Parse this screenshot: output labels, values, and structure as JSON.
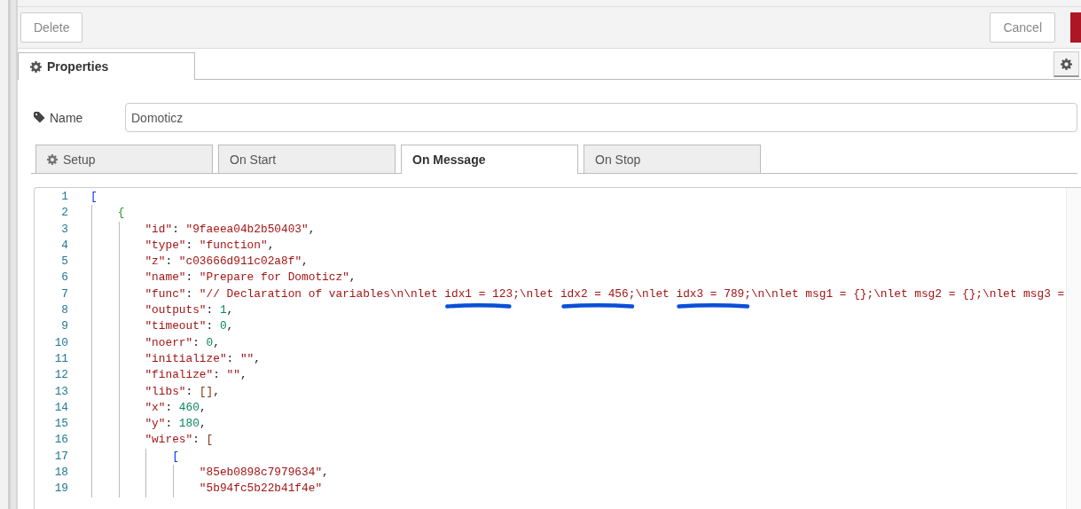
{
  "toolbar": {
    "delete_button": "Delete",
    "cancel_button": "Cancel"
  },
  "tray_tabs": [
    {
      "label": "Properties",
      "selected": true
    }
  ],
  "name_field": {
    "label": "Name",
    "value": "Domoticz"
  },
  "editor_tabs": [
    {
      "label": "Setup",
      "icon": true,
      "selected": false
    },
    {
      "label": "On Start",
      "icon": false,
      "selected": false
    },
    {
      "label": "On Message",
      "icon": false,
      "selected": true
    },
    {
      "label": "On Stop",
      "icon": false,
      "selected": false
    }
  ],
  "code": [
    {
      "number": "1",
      "tokens": [
        {
          "kind": "bracket1",
          "text": "["
        }
      ],
      "children": [
        {
          "number": "2",
          "tokens": [
            {
              "kind": "bracket2",
              "text": "{"
            }
          ],
          "children": [
            {
              "number": "3",
              "tokens": [
                {
                  "kind": "key",
                  "text": "\"id\""
                },
                {
                  "kind": "punct",
                  "text": ": "
                },
                {
                  "kind": "string",
                  "text": "\"9faeea04b2b50403\""
                },
                {
                  "kind": "punct",
                  "text": ","
                }
              ]
            },
            {
              "number": "4",
              "tokens": [
                {
                  "kind": "key",
                  "text": "\"type\""
                },
                {
                  "kind": "punct",
                  "text": ": "
                },
                {
                  "kind": "string",
                  "text": "\"function\""
                },
                {
                  "kind": "punct",
                  "text": ","
                }
              ]
            },
            {
              "number": "5",
              "tokens": [
                {
                  "kind": "key",
                  "text": "\"z\""
                },
                {
                  "kind": "punct",
                  "text": ": "
                },
                {
                  "kind": "string",
                  "text": "\"c03666d911c02a8f\""
                },
                {
                  "kind": "punct",
                  "text": ","
                }
              ]
            },
            {
              "number": "6",
              "tokens": [
                {
                  "kind": "key",
                  "text": "\"name\""
                },
                {
                  "kind": "punct",
                  "text": ": "
                },
                {
                  "kind": "string",
                  "text": "\"Prepare for Domoticz\""
                },
                {
                  "kind": "punct",
                  "text": ","
                }
              ]
            },
            {
              "number": "7",
              "tokens": [
                {
                  "kind": "key",
                  "text": "\"func\""
                },
                {
                  "kind": "punct",
                  "text": ": "
                },
                {
                  "kind": "string",
                  "text": "\"// Declaration of variables\\n\\nlet "
                },
                {
                  "kind": "string",
                  "text": "idx1 = 123",
                  "underlined": true
                },
                {
                  "kind": "string",
                  "text": ";\\nlet "
                },
                {
                  "kind": "string",
                  "text": "idx2 = 456;",
                  "underlined": true
                },
                {
                  "kind": "string",
                  "text": "\\nlet "
                },
                {
                  "kind": "string",
                  "text": "idx3 = 789;",
                  "underlined": true
                },
                {
                  "kind": "string",
                  "text": "\\n\\nlet msg1 = {};\\nlet msg2 = {};\\nlet msg3 ="
                }
              ]
            },
            {
              "number": "8",
              "tokens": [
                {
                  "kind": "key",
                  "text": "\"outputs\""
                },
                {
                  "kind": "punct",
                  "text": ": "
                },
                {
                  "kind": "number",
                  "text": "1"
                },
                {
                  "kind": "punct",
                  "text": ","
                }
              ]
            },
            {
              "number": "9",
              "tokens": [
                {
                  "kind": "key",
                  "text": "\"timeout\""
                },
                {
                  "kind": "punct",
                  "text": ": "
                },
                {
                  "kind": "number",
                  "text": "0"
                },
                {
                  "kind": "punct",
                  "text": ","
                }
              ]
            },
            {
              "number": "10",
              "tokens": [
                {
                  "kind": "key",
                  "text": "\"noerr\""
                },
                {
                  "kind": "punct",
                  "text": ": "
                },
                {
                  "kind": "number",
                  "text": "0"
                },
                {
                  "kind": "punct",
                  "text": ","
                }
              ]
            },
            {
              "number": "11",
              "tokens": [
                {
                  "kind": "key",
                  "text": "\"initialize\""
                },
                {
                  "kind": "punct",
                  "text": ": "
                },
                {
                  "kind": "string",
                  "text": "\"\""
                },
                {
                  "kind": "punct",
                  "text": ","
                }
              ]
            },
            {
              "number": "12",
              "tokens": [
                {
                  "kind": "key",
                  "text": "\"finalize\""
                },
                {
                  "kind": "punct",
                  "text": ": "
                },
                {
                  "kind": "string",
                  "text": "\"\""
                },
                {
                  "kind": "punct",
                  "text": ","
                }
              ]
            },
            {
              "number": "13",
              "tokens": [
                {
                  "kind": "key",
                  "text": "\"libs\""
                },
                {
                  "kind": "punct",
                  "text": ": "
                },
                {
                  "kind": "bracket3",
                  "text": "[]"
                },
                {
                  "kind": "punct",
                  "text": ","
                }
              ]
            },
            {
              "number": "14",
              "tokens": [
                {
                  "kind": "key",
                  "text": "\"x\""
                },
                {
                  "kind": "punct",
                  "text": ": "
                },
                {
                  "kind": "number",
                  "text": "460"
                },
                {
                  "kind": "punct",
                  "text": ","
                }
              ]
            },
            {
              "number": "15",
              "tokens": [
                {
                  "kind": "key",
                  "text": "\"y\""
                },
                {
                  "kind": "punct",
                  "text": ": "
                },
                {
                  "kind": "number",
                  "text": "180"
                },
                {
                  "kind": "punct",
                  "text": ","
                }
              ]
            },
            {
              "number": "16",
              "tokens": [
                {
                  "kind": "key",
                  "text": "\"wires\""
                },
                {
                  "kind": "punct",
                  "text": ": "
                },
                {
                  "kind": "bracket3",
                  "text": "["
                }
              ],
              "children": [
                {
                  "number": "17",
                  "tokens": [
                    {
                      "kind": "bracket1",
                      "text": "["
                    }
                  ],
                  "children": [
                    {
                      "number": "18",
                      "tokens": [
                        {
                          "kind": "string",
                          "text": "\"85eb0898c7979634\""
                        },
                        {
                          "kind": "punct",
                          "text": ","
                        }
                      ]
                    },
                    {
                      "number": "19",
                      "tokens": [
                        {
                          "kind": "string",
                          "text": "\"5b94fc5b22b41f4e\""
                        }
                      ]
                    }
                  ]
                }
              ]
            }
          ]
        }
      ]
    }
  ]
}
